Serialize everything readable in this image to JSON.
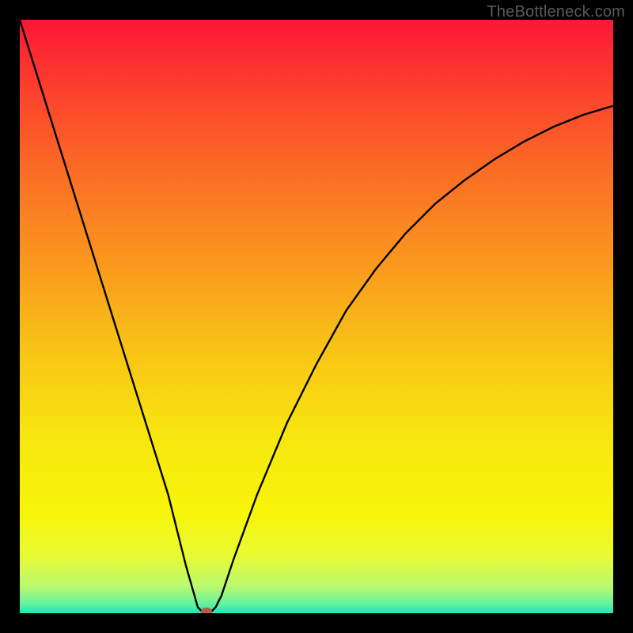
{
  "watermark": "TheBottleneck.com",
  "colors": {
    "frame": "#000000",
    "curve": "#000000",
    "marker": "#b85c4a",
    "gradient_stops": [
      {
        "pos": 0.0,
        "hex": "#fc1836"
      },
      {
        "pos": 0.1,
        "hex": "#fc3a2e"
      },
      {
        "pos": 0.25,
        "hex": "#fb6b25"
      },
      {
        "pos": 0.4,
        "hex": "#fa951e"
      },
      {
        "pos": 0.55,
        "hex": "#f8c216"
      },
      {
        "pos": 0.7,
        "hex": "#f7e60f"
      },
      {
        "pos": 0.83,
        "hex": "#f7f509"
      },
      {
        "pos": 0.9,
        "hex": "#eafa31"
      },
      {
        "pos": 0.955,
        "hex": "#b9f96f"
      },
      {
        "pos": 0.985,
        "hex": "#63f2a1"
      },
      {
        "pos": 1.0,
        "hex": "#16e7b8"
      }
    ]
  },
  "chart_data": {
    "type": "line",
    "title": "",
    "xlabel": "",
    "ylabel": "",
    "xlim": [
      0,
      100
    ],
    "ylim": [
      0,
      100
    ],
    "series": [
      {
        "name": "bottleneck-curve",
        "x": [
          0,
          5,
          10,
          15,
          20,
          25,
          28,
          30,
          31,
          32,
          33,
          34,
          36,
          40,
          45,
          50,
          55,
          60,
          65,
          70,
          75,
          80,
          85,
          90,
          95,
          100
        ],
        "values": [
          100,
          84,
          68,
          52,
          36,
          20,
          8,
          1,
          0,
          0,
          1,
          3,
          9,
          20,
          32,
          42,
          51,
          58,
          64,
          69,
          73,
          76.5,
          79.5,
          82,
          84,
          85.5
        ]
      }
    ],
    "marker": {
      "x": 31.5,
      "y": 0,
      "name": "optimum-point"
    }
  }
}
